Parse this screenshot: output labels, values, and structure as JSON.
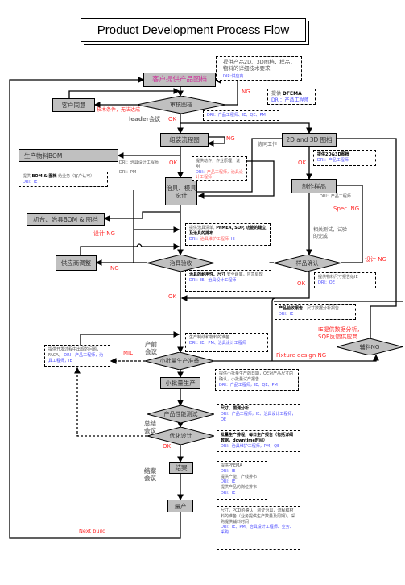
{
  "title": "Product Development Process Flow",
  "nodes": {
    "customer_drawings": "客户提供产品图档",
    "review_drawings": "审核图档",
    "customer_agree": "客户同意",
    "assembly_flow": "组装流程图",
    "drawings_2d3d": "2D and 3D 图档",
    "material_bom": "生产物料BOM",
    "fixture_design": "治具、模具设计",
    "make_sample": "制作样品",
    "machine_bom": "机台、治具BOM & 图档",
    "supplier_adjust": "供应商调整",
    "fixture_acceptance": "治具验收",
    "sample_confirm": "样品确认",
    "aux_ng": "辅料NG",
    "pilot_prep": "小批量生产准备",
    "pilot_run": "小批量生产",
    "performance_test": "产品性能测试",
    "optimize_design": "优化设计",
    "close_case": "结案",
    "mass_production": "量产"
  },
  "labels": {
    "ng1": "NG",
    "ng2": "NG",
    "ng3": "NG",
    "tech_fail": "技术条件，无法达成",
    "ok1": "OK",
    "ok2": "OK",
    "ok3": "OK",
    "ok4": "OK",
    "ok5": "OK",
    "ok6": "OK",
    "leader_meeting": "leader会议",
    "cowork": "协同工作",
    "dri_fixture_eng": "DRI：治具设计工程师",
    "dri_pm": "DRI：PM",
    "dri_pe": "DRI：产品工程师",
    "spec_ng": "Spec. NG",
    "design_ng1": "设计 NG",
    "design_ng2": "设计 NG",
    "tests": "相关测试，试验的完成",
    "ie_analysis": "IE提供数据分析，SQE反馈供应商",
    "fixture_design_ng": "Fixture design NG",
    "mil": "MIL",
    "pre_meeting": "产前会议",
    "summary_meeting": "总结会议",
    "close_meeting": "结案会议",
    "next_build": "Next build"
  },
  "notes": {
    "n_top": {
      "text": "提供产品2D、3D图档，样品，物料的详细技术要求",
      "dri": "DIR:供应商"
    },
    "n_dfema": {
      "pre": "提供 ",
      "bold": "DFEMA",
      "dri": "DRI：产品工程师"
    },
    "n_review_dri": {
      "dri": "DRI：产品工程师、IE、QE、PM"
    },
    "n_action": {
      "text": "提供动作，作业原理，说明",
      "dri": "DRI：",
      "dri_red": "产品工程师，治具设计工程师"
    },
    "n_2d3d": {
      "bold": "提供2D&3D图档",
      "dri": "DRI：产品工程师"
    },
    "n_bom": {
      "pre": "提供 ",
      "bold": "BOM & 图档",
      "post": " 给业务（客户认可）",
      "dri": "DRI：IE"
    },
    "n_pfmea": {
      "text": "提供治具清单, ",
      "bold": "PFMEA, SOP, 功能的建立及治具的排布",
      "dri": "DRI：",
      "dri_red": "治具维护工程师",
      "dri_tail": ", IE"
    },
    "n_fixture_check": {
      "bold": "治具的耐用性、尺寸",
      "text": " 安全距离，应急处理",
      "dri": "DRI：IE、治具设计工程师"
    },
    "n_material_report": {
      "text": "提供物料尺寸报告给IE",
      "dri": "DRI：QE"
    },
    "n_acceptance_report": {
      "bold": "产品验收报告",
      "text": "、尺寸数据分析报告",
      "dri": "DRI：IE"
    },
    "n_line_prep": {
      "text": "生产制线和物料的准备",
      "dri": "DRI：IE、PM、治具设计工程师"
    },
    "n_issues": {
      "text": "提供开发过程中出现的问题，FACA。",
      "dri": "DRI：产品工程师，治具工程师，IE"
    },
    "n_pilot": {
      "text": "提供小批量生产的日期，QE对产品尺寸的确认，小批量试产报告",
      "dri": "DRI：产品工程师，IE、QE、PM"
    },
    "n_dim": {
      "bold": "尺寸、圆测分析",
      "dri": "DRI：产品工程师，IE、治具设计工程师，QE"
    },
    "n_schedule": {
      "bold": "批量生产排程，每日生产报告（包括详细数据，downtime时间）",
      "dri": "DRI：治具维护工程师，PM，QE"
    },
    "n_pfema": {
      "l1": "提供PFEMA",
      "d1": "DRI：IE",
      "l2": "提供产能，产线排布",
      "d2": "DRI：IE",
      "l3": "提供产品的岗位排布",
      "d3": "DRI：IE"
    },
    "n_pcd": {
      "text": "尺寸，PCD的确认，验证治具，流程和材料的准备（业务提供生产数量及周期），采购提供辅料时间",
      "dri": "DRI：IE、PM、治具设计工程师、业务、采购"
    }
  },
  "colors": {
    "box_fill": "#c0c0c0",
    "ng_red": "#ff2a2a",
    "dri_blue": "#4a4aff",
    "title_magenta": "#cc3399",
    "meeting_gray": "#777777"
  }
}
